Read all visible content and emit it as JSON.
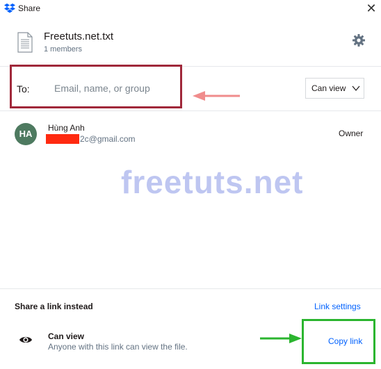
{
  "window": {
    "title": "Share",
    "close_glyph": "✕"
  },
  "file": {
    "name": "Freetuts.net.txt",
    "members": "1 members"
  },
  "share_to": {
    "label": "To:",
    "placeholder": "Email, name, or group",
    "permission": "Can view"
  },
  "member": {
    "initials": "HA",
    "name": "Hùng Anh",
    "email_visible": "2c@gmail.com",
    "role": "Owner"
  },
  "watermark": "freetuts.net",
  "link_section": {
    "heading": "Share a link instead",
    "settings_link": "Link settings",
    "permission": "Can view",
    "description": "Anyone with this link can view the file.",
    "copy_link": "Copy link"
  },
  "colors": {
    "dropbox_blue": "#0061fe",
    "avatar_green": "#4e7a60",
    "highlight_red": "#a0283a",
    "highlight_green": "#2bb52f",
    "redaction_red": "#ff2a10"
  },
  "icons": [
    "dropbox-logo-icon",
    "close-icon",
    "file-icon",
    "gear-icon",
    "chevron-down-icon",
    "eye-icon",
    "arrow-left-icon",
    "arrow-right-icon"
  ]
}
